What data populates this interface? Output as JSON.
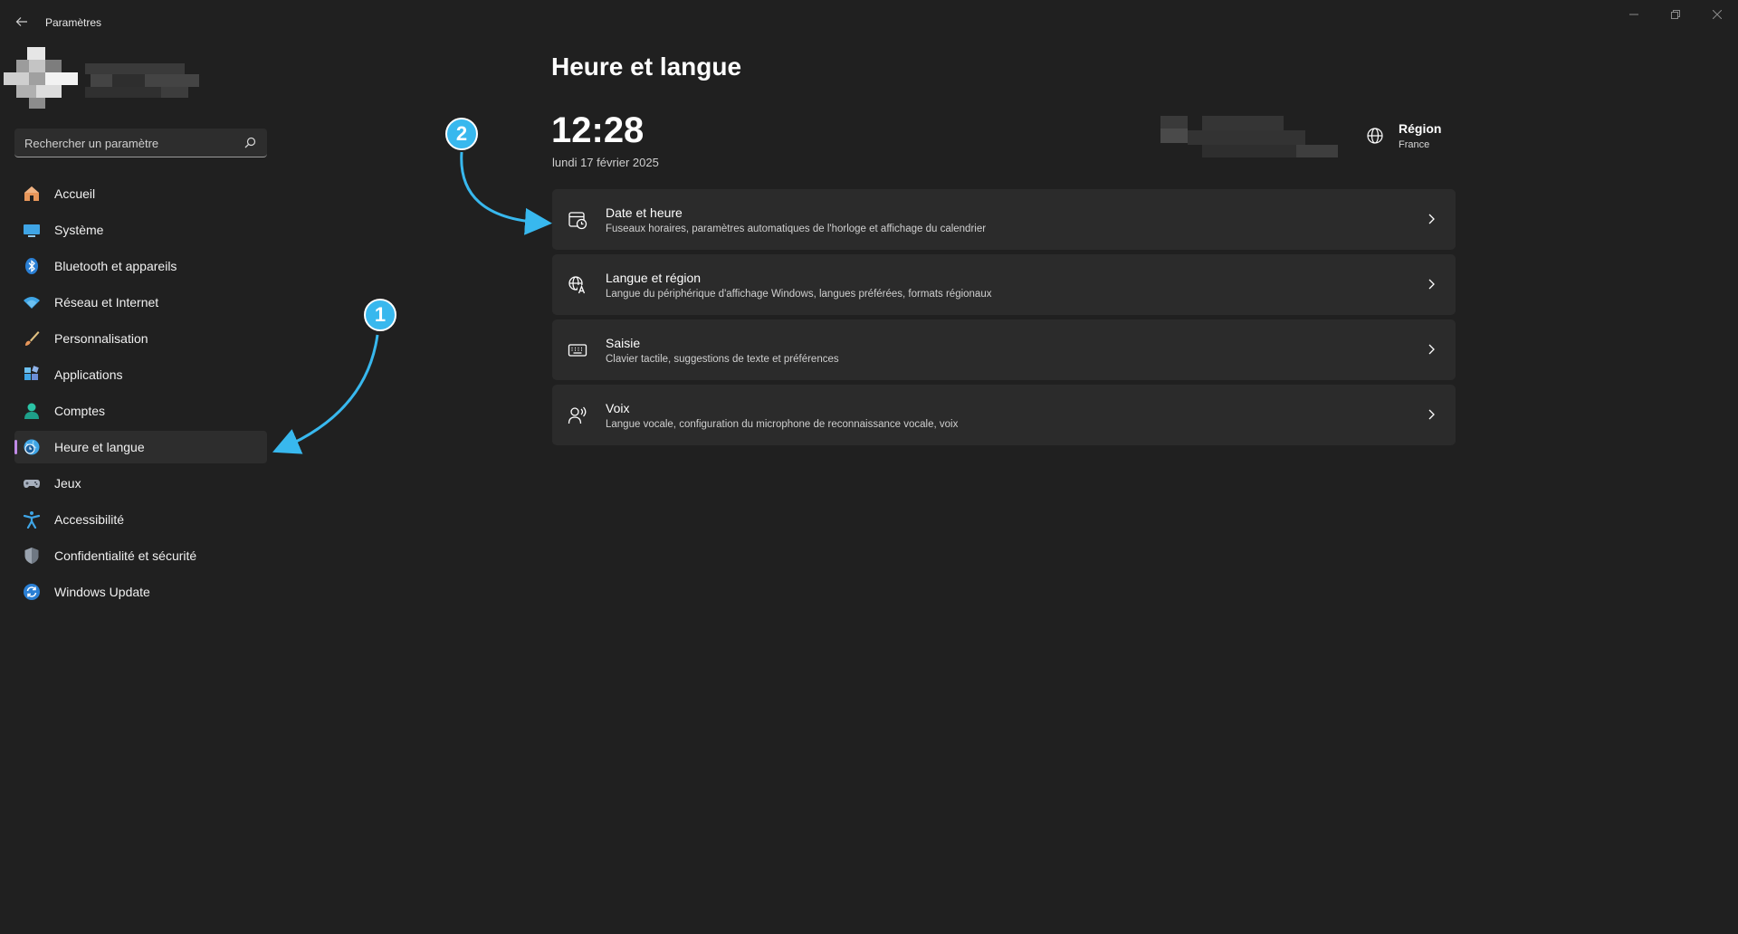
{
  "window": {
    "title": "Paramètres",
    "controls": [
      "minimize-icon",
      "restore-icon",
      "close-icon"
    ]
  },
  "search": {
    "placeholder": "Rechercher un paramètre"
  },
  "sidebar": {
    "items": [
      {
        "label": "Accueil",
        "icon": "home-icon"
      },
      {
        "label": "Système",
        "icon": "display-icon"
      },
      {
        "label": "Bluetooth et appareils",
        "icon": "bluetooth-icon"
      },
      {
        "label": "Réseau et Internet",
        "icon": "wifi-icon"
      },
      {
        "label": "Personnalisation",
        "icon": "brush-icon"
      },
      {
        "label": "Applications",
        "icon": "apps-icon"
      },
      {
        "label": "Comptes",
        "icon": "person-icon"
      },
      {
        "label": "Heure et langue",
        "icon": "globe-clock-icon",
        "active": true
      },
      {
        "label": "Jeux",
        "icon": "gamepad-icon"
      },
      {
        "label": "Accessibilité",
        "icon": "accessibility-icon"
      },
      {
        "label": "Confidentialité et sécurité",
        "icon": "shield-icon"
      },
      {
        "label": "Windows Update",
        "icon": "update-icon"
      }
    ]
  },
  "main": {
    "title": "Heure et langue",
    "time": "12:28",
    "date": "lundi 17 février 2025",
    "region": {
      "label": "Région",
      "value": "France"
    },
    "cards": [
      {
        "title": "Date et heure",
        "desc": "Fuseaux horaires, paramètres automatiques de l'horloge et affichage du calendrier",
        "icon": "calendar-clock-icon"
      },
      {
        "title": "Langue et région",
        "desc": "Langue du périphérique d'affichage Windows, langues préférées, formats régionaux",
        "icon": "language-icon"
      },
      {
        "title": "Saisie",
        "desc": "Clavier tactile, suggestions de texte et préférences",
        "icon": "keyboard-icon"
      },
      {
        "title": "Voix",
        "desc": "Langue vocale, configuration du microphone de reconnaissance vocale, voix",
        "icon": "speech-icon"
      }
    ]
  },
  "annotations": {
    "badge1": "1",
    "badge2": "2",
    "color": "#38b8ee"
  },
  "colors": {
    "background": "#202020",
    "card": "#2b2b2b",
    "accent": "#c08ae6"
  }
}
